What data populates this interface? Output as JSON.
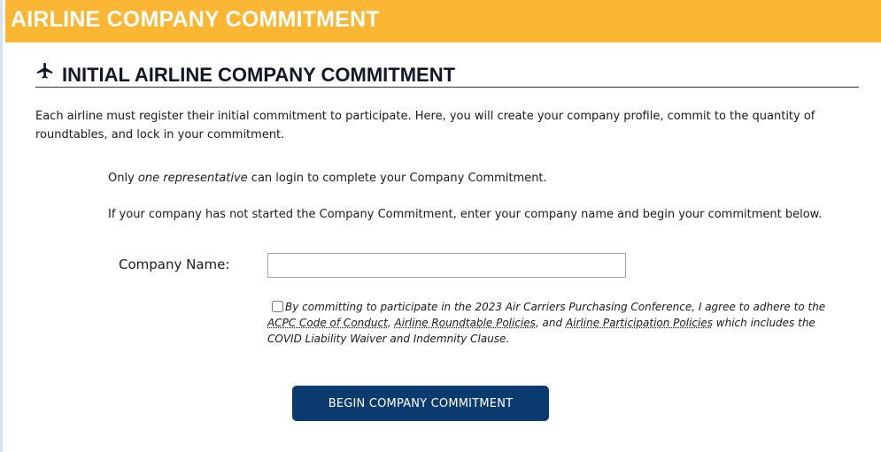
{
  "header": {
    "title": "AIRLINE COMPANY COMMITMENT"
  },
  "section": {
    "icon": "airplane-icon",
    "title": "INITIAL AIRLINE COMPANY COMMITMENT",
    "intro": "Each airline must register their initial commitment to participate. Here, you will create your company profile, commit to the quantity of roundtables, and lock in your commitment."
  },
  "notes": {
    "rep_prefix": "Only ",
    "rep_emphasis": "one representative",
    "rep_suffix": " can login to complete your Company Commitment.",
    "start": "If your company has not started the Company Commitment, enter your company name and begin your commitment below."
  },
  "form": {
    "company_label": "Company Name:",
    "company_value": "",
    "agreement": {
      "checked": false,
      "text_before": "By committing to participate in the 2023 Air Carriers Purchasing Conference, I agree to adhere to the ",
      "link_conduct": "ACPC Code of Conduct",
      "sep1": ", ",
      "link_roundtable": "Airline Roundtable Policies",
      "sep2": ", and ",
      "link_participation": "Airline Participation Policies",
      "text_after": " which includes the COVID Liability Waiver and Indemnity Clause."
    },
    "submit_label": "BEGIN COMPANY COMMITMENT"
  },
  "colors": {
    "header_bg": "#fbb734",
    "button_bg": "#0b3a6e"
  }
}
